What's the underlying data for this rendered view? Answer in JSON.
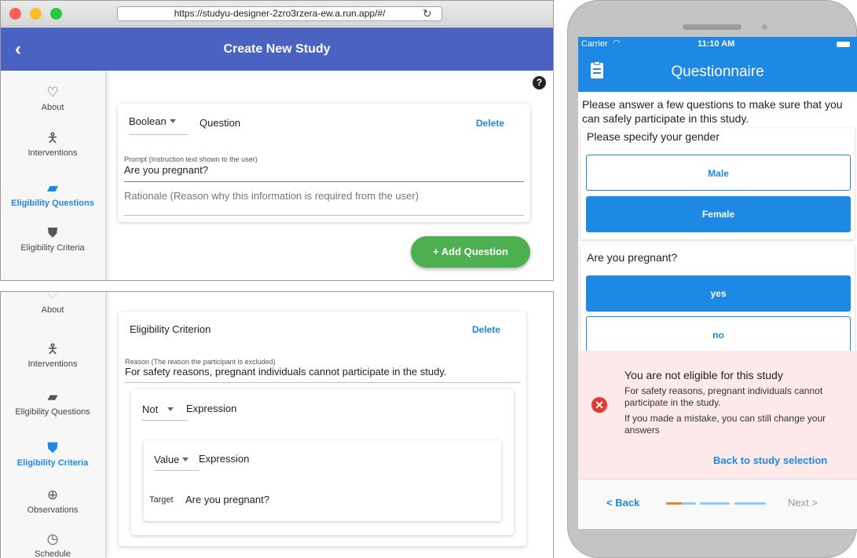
{
  "browser": {
    "url": "https://studyu-designer-2zro3rzera-ew.a.run.app/#/",
    "title": "Create New Study",
    "nav": [
      {
        "label": "About",
        "icon": "heart-outline-icon",
        "glyph": "♡",
        "active": false
      },
      {
        "label": "Interventions",
        "icon": "person-icon",
        "glyph": "🯅",
        "active": false
      },
      {
        "label": "Eligibility Questions",
        "icon": "chat-icon",
        "glyph": "▰",
        "active": true
      },
      {
        "label": "Eligibility Criteria",
        "icon": "shield-icon",
        "glyph": "⛊",
        "active": false
      }
    ],
    "question_card": {
      "type_value": "Boolean",
      "type_suffix": "Question",
      "delete_label": "Delete",
      "prompt_label": "Prompt (Instruction text shown to the user)",
      "prompt_value": "Are you pregnant?",
      "rationale_placeholder": "Rationale (Reason why this information is required from the user)"
    },
    "help_glyph": "?",
    "add_question_label": "+  Add Question"
  },
  "panel2": {
    "nav": [
      {
        "label": "About",
        "icon": "heart-outline-icon",
        "glyph": "♡",
        "active": false
      },
      {
        "label": "Interventions",
        "icon": "person-icon",
        "glyph": "🯅",
        "active": false
      },
      {
        "label": "Eligibility Questions",
        "icon": "chat-icon",
        "glyph": "▰",
        "active": false
      },
      {
        "label": "Eligibility Criteria",
        "icon": "shield-check-icon",
        "glyph": "⛊",
        "active": true
      },
      {
        "label": "Observations",
        "icon": "zoom-icon",
        "glyph": "⊕",
        "active": false
      },
      {
        "label": "Schedule",
        "icon": "clock-icon",
        "glyph": "◷",
        "active": false
      }
    ],
    "criterion_card": {
      "title": "Eligibility Criterion",
      "delete_label": "Delete",
      "reason_label": "Reason (The reason the participant is excluded)",
      "reason_value": "For safety reasons, pregnant individuals cannot participate in the study.",
      "not_value": "Not",
      "not_suffix": "Expression",
      "value_value": "Value",
      "value_suffix": "Expression",
      "target_label": "Target",
      "target_value": "Are you pregnant?"
    }
  },
  "phone": {
    "carrier": "Carrier",
    "time": "11:10 AM",
    "title": "Questionnaire",
    "intro": "Please answer a few questions to make sure that you can safely participate in this study.",
    "q1": {
      "text": "Please specify your gender",
      "options": [
        "Male",
        "Female"
      ],
      "selected": "Female"
    },
    "q2": {
      "text": "Are you pregnant?",
      "options": [
        "yes",
        "no"
      ],
      "selected": "yes"
    },
    "banner": {
      "title": "You are not eligible for this study",
      "body": "For safety reasons, pregnant individuals cannot participate in the study.",
      "hint": "If you made a mistake, you can still change your answers",
      "link": "Back to study selection"
    },
    "back_label": "< Back",
    "next_label": "Next >",
    "progress_steps": 3,
    "progress_current": 1,
    "colors": {
      "primary": "#1e88e5",
      "error": "#e53935",
      "progress_active": "#f5821f"
    }
  }
}
